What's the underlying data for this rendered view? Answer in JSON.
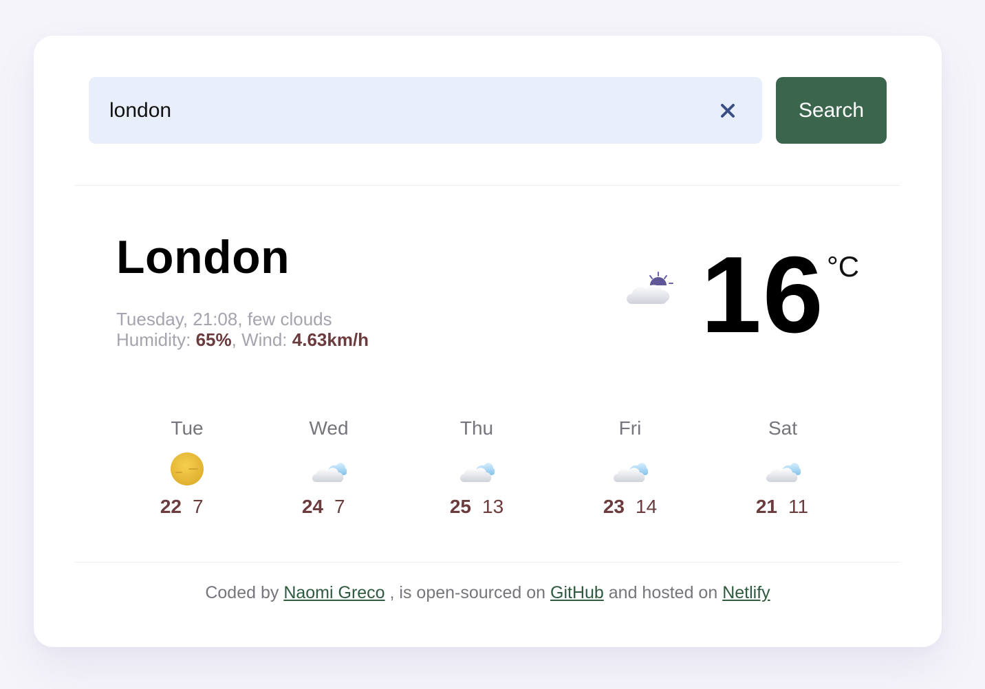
{
  "search": {
    "value": "london",
    "button_label": "Search"
  },
  "current": {
    "city": "London",
    "description": "Tuesday, 21:08, few clouds",
    "humidity_label": "Humidity: ",
    "humidity": "65%",
    "wind_label": ", Wind: ",
    "wind": "4.63km/h",
    "icon": "few-clouds-night-icon",
    "temperature": "16",
    "unit": "°C"
  },
  "forecast": [
    {
      "day": "Tue",
      "max": "22",
      "min": "7",
      "icon": "clear-sky-icon"
    },
    {
      "day": "Wed",
      "max": "24",
      "min": "7",
      "icon": "clouds-icon"
    },
    {
      "day": "Thu",
      "max": "25",
      "min": "13",
      "icon": "clouds-icon"
    },
    {
      "day": "Fri",
      "max": "23",
      "min": "14",
      "icon": "clouds-icon"
    },
    {
      "day": "Sat",
      "max": "21",
      "min": "11",
      "icon": "clouds-icon"
    }
  ],
  "footer": {
    "prefix": "Coded by ",
    "author": "Naomi Greco",
    "middle": " , is open-sourced on ",
    "repo": "GitHub",
    "middle2": " and hosted on ",
    "host": "Netlify"
  },
  "colors": {
    "accent": "#3b664d",
    "input_bg": "#e8effb",
    "highlight_text": "#6b3b3e",
    "muted_text": "#a6a3ae"
  }
}
